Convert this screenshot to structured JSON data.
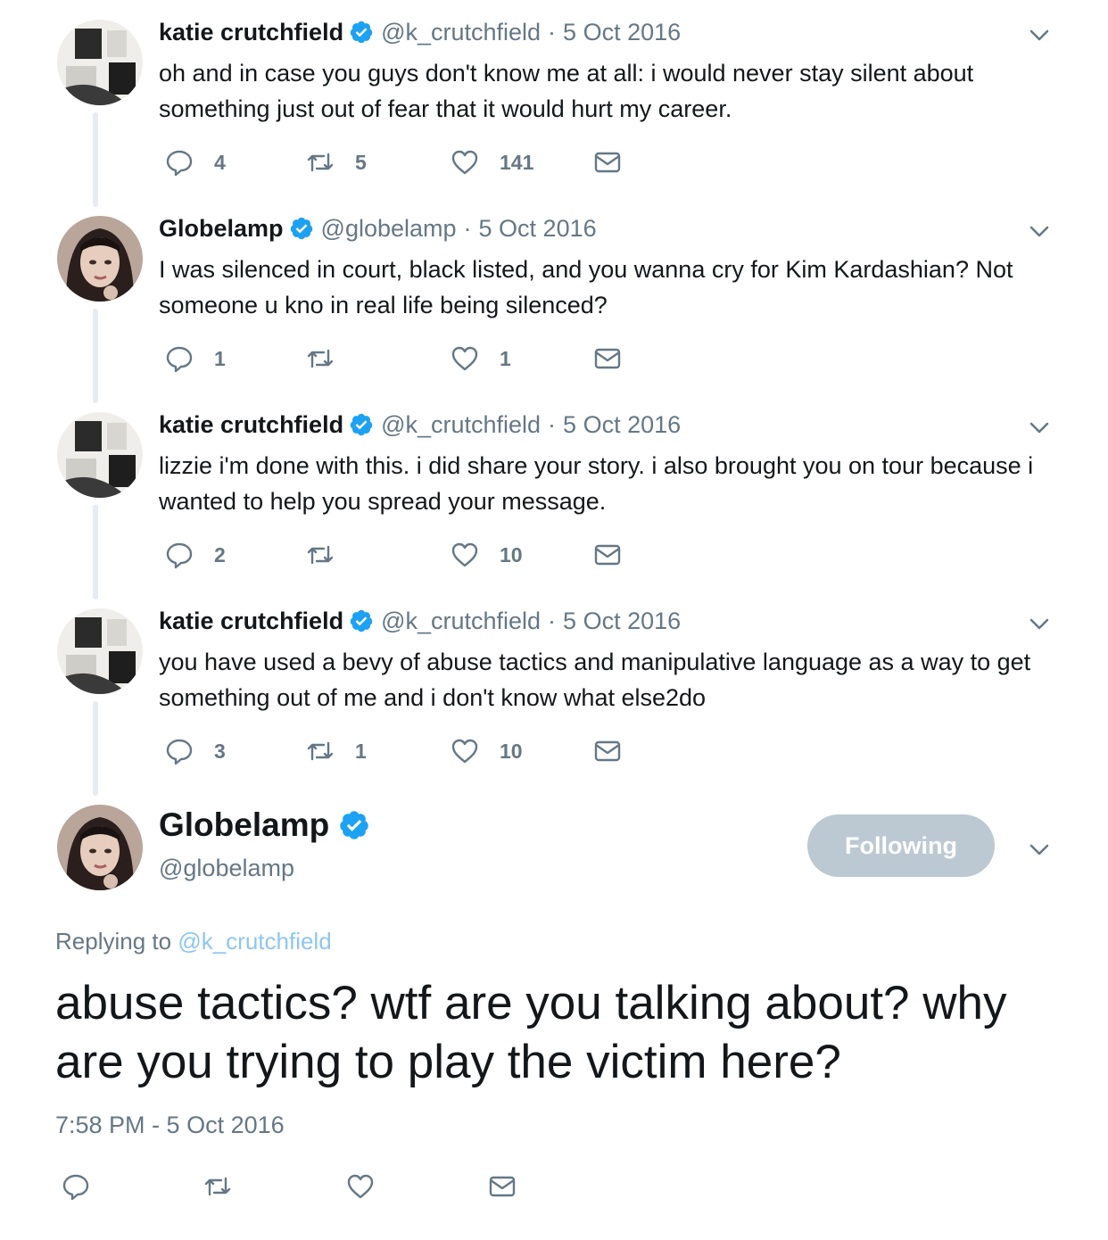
{
  "colors": {
    "accent": "#1da1f2",
    "muted": "#657786",
    "text": "#14171a",
    "follow_bg": "#bcc9d2",
    "line": "#e6ecf0"
  },
  "thread": [
    {
      "name": "katie crutchfield",
      "handle": "@k_crutchfield",
      "separator": "·",
      "date": "5 Oct 2016",
      "text": "oh and in case you guys don't know me at all: i would never stay silent about something just out of fear that it would hurt my career.",
      "replies": "4",
      "retweets": "5",
      "likes": "141"
    },
    {
      "name": "Globelamp",
      "handle": "@globelamp",
      "separator": "·",
      "date": "5 Oct 2016",
      "text": "I was silenced in court, black listed, and you wanna cry for Kim Kardashian? Not someone u kno in real life being silenced?",
      "replies": "1",
      "retweets": "",
      "likes": "1"
    },
    {
      "name": "katie crutchfield",
      "handle": "@k_crutchfield",
      "separator": "·",
      "date": "5 Oct 2016",
      "text": "lizzie i'm done with this. i did share your story. i also brought you on tour because i wanted to help you spread your message.",
      "replies": "2",
      "retweets": "",
      "likes": "10"
    },
    {
      "name": "katie crutchfield",
      "handle": "@k_crutchfield",
      "separator": "·",
      "date": "5 Oct 2016",
      "text": "you have used a bevy of abuse tactics and manipulative language as a way to get something out of me and i don't know what else2do",
      "replies": "3",
      "retweets": "1",
      "likes": "10"
    }
  ],
  "main": {
    "name": "Globelamp",
    "handle": "@globelamp",
    "follow_label": "Following",
    "replying_prefix": "Replying to",
    "replying_to": "@k_crutchfield",
    "text": "abuse tactics? wtf are you talking about? why are you trying to play the victim here?",
    "timestamp": "7:58 PM - 5 Oct 2016"
  },
  "icons": [
    "reply-icon",
    "retweet-icon",
    "like-icon",
    "dm-icon",
    "verified-icon",
    "chevron-down-icon"
  ]
}
